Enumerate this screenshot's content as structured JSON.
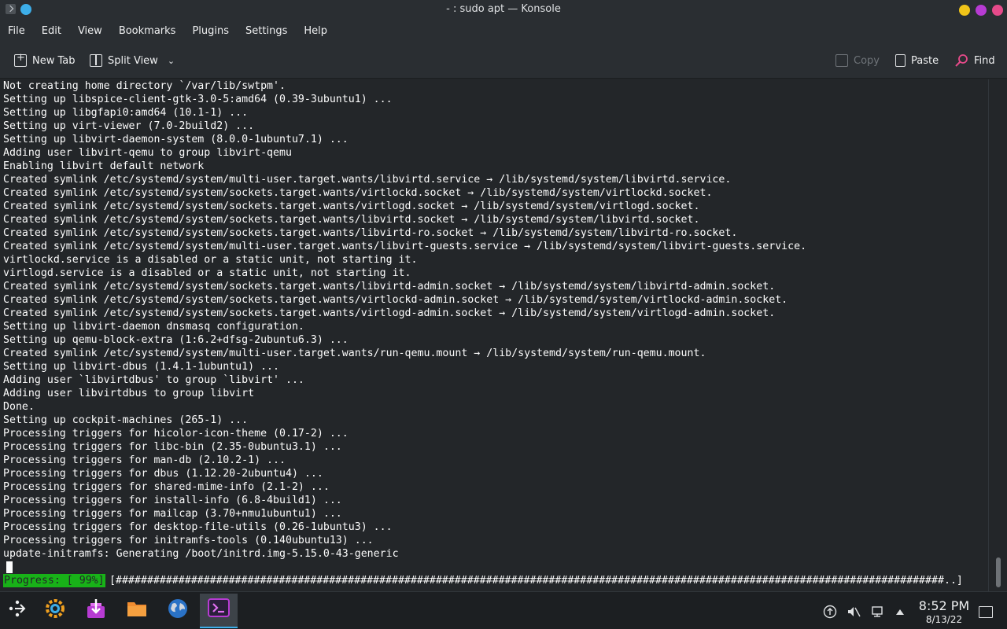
{
  "window": {
    "title": "- : sudo apt — Konsole"
  },
  "colors": {
    "background": "#232629",
    "chrome": "#2a2e32",
    "progress_green": "#18b218",
    "accent": "#3daee9"
  },
  "menubar": {
    "items": [
      "File",
      "Edit",
      "View",
      "Bookmarks",
      "Plugins",
      "Settings",
      "Help"
    ]
  },
  "toolbar": {
    "new_tab": "New Tab",
    "split_view": "Split View",
    "copy": "Copy",
    "paste": "Paste",
    "find": "Find"
  },
  "terminal": {
    "lines": [
      "Not creating home directory `/var/lib/swtpm'.",
      "Setting up libspice-client-gtk-3.0-5:amd64 (0.39-3ubuntu1) ...",
      "Setting up libgfapi0:amd64 (10.1-1) ...",
      "Setting up virt-viewer (7.0-2build2) ...",
      "Setting up libvirt-daemon-system (8.0.0-1ubuntu7.1) ...",
      "Adding user libvirt-qemu to group libvirt-qemu",
      "Enabling libvirt default network",
      "Created symlink /etc/systemd/system/multi-user.target.wants/libvirtd.service → /lib/systemd/system/libvirtd.service.",
      "Created symlink /etc/systemd/system/sockets.target.wants/virtlockd.socket → /lib/systemd/system/virtlockd.socket.",
      "Created symlink /etc/systemd/system/sockets.target.wants/virtlogd.socket → /lib/systemd/system/virtlogd.socket.",
      "Created symlink /etc/systemd/system/sockets.target.wants/libvirtd.socket → /lib/systemd/system/libvirtd.socket.",
      "Created symlink /etc/systemd/system/sockets.target.wants/libvirtd-ro.socket → /lib/systemd/system/libvirtd-ro.socket.",
      "Created symlink /etc/systemd/system/multi-user.target.wants/libvirt-guests.service → /lib/systemd/system/libvirt-guests.service.",
      "virtlockd.service is a disabled or a static unit, not starting it.",
      "virtlogd.service is a disabled or a static unit, not starting it.",
      "Created symlink /etc/systemd/system/sockets.target.wants/libvirtd-admin.socket → /lib/systemd/system/libvirtd-admin.socket.",
      "Created symlink /etc/systemd/system/sockets.target.wants/virtlockd-admin.socket → /lib/systemd/system/virtlockd-admin.socket.",
      "Created symlink /etc/systemd/system/sockets.target.wants/virtlogd-admin.socket → /lib/systemd/system/virtlogd-admin.socket.",
      "Setting up libvirt-daemon dnsmasq configuration.",
      "Setting up qemu-block-extra (1:6.2+dfsg-2ubuntu6.3) ...",
      "Created symlink /etc/systemd/system/multi-user.target.wants/run-qemu.mount → /lib/systemd/system/run-qemu.mount.",
      "Setting up libvirt-dbus (1.4.1-1ubuntu1) ...",
      "Adding user `libvirtdbus' to group `libvirt' ...",
      "Adding user libvirtdbus to group libvirt",
      "Done.",
      "Setting up cockpit-machines (265-1) ...",
      "Processing triggers for hicolor-icon-theme (0.17-2) ...",
      "Processing triggers for libc-bin (2.35-0ubuntu3.1) ...",
      "Processing triggers for man-db (2.10.2-1) ...",
      "Processing triggers for dbus (1.12.20-2ubuntu4) ...",
      "Processing triggers for shared-mime-info (2.1-2) ...",
      "Processing triggers for install-info (6.8-4build1) ...",
      "Processing triggers for mailcap (3.70+nmu1ubuntu1) ...",
      "Processing triggers for desktop-file-utils (0.26-1ubuntu3) ...",
      "Processing triggers for initramfs-tools (0.140ubuntu13) ...",
      "update-initramfs: Generating /boot/initrd.img-5.15.0-43-generic"
    ],
    "progress_label": "Progress: [ 99%]",
    "progress_bar": "[####################################################################################################################################..]",
    "progress_percent": 99
  },
  "taskbar": {
    "apps": [
      {
        "name": "application-launcher-icon",
        "glyph": "✦"
      },
      {
        "name": "settings-icon",
        "glyph": "⚙"
      },
      {
        "name": "discover-icon",
        "glyph": "⬇"
      },
      {
        "name": "files-icon",
        "glyph": "📁"
      },
      {
        "name": "browser-icon",
        "glyph": "🌐"
      },
      {
        "name": "konsole-icon",
        "glyph": "⌨"
      }
    ],
    "clock_time": "8:52 PM",
    "clock_date": "8/13/22"
  }
}
